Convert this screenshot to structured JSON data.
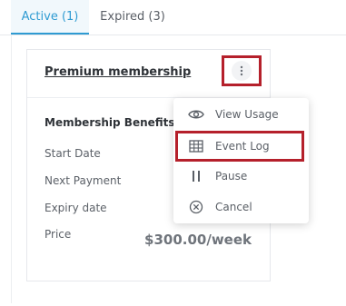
{
  "tabs": [
    {
      "label": "Active (1)",
      "active": true
    },
    {
      "label": "Expired (3)",
      "active": false
    }
  ],
  "card": {
    "title": "Premium membership",
    "fields": [
      {
        "label": "Membership Benefits"
      },
      {
        "label": "Start Date"
      },
      {
        "label": "Next Payment"
      },
      {
        "label": "Expiry date"
      },
      {
        "label": "Price"
      }
    ],
    "price": "$300.00/week"
  },
  "menu": {
    "items": [
      {
        "label": "View Usage",
        "icon": "eye-icon"
      },
      {
        "label": "Event Log",
        "icon": "table-icon"
      },
      {
        "label": "Pause",
        "icon": "pause-icon"
      },
      {
        "label": "Cancel",
        "icon": "cancel-icon"
      }
    ]
  },
  "colors": {
    "accent": "#2f9bd2",
    "highlight_outline": "#b5202b"
  }
}
